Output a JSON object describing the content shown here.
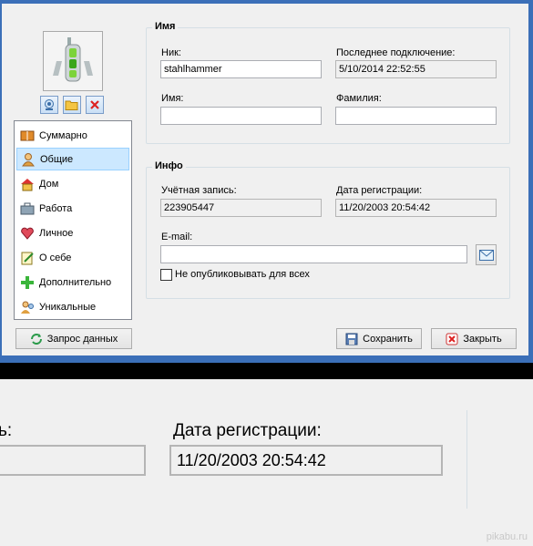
{
  "colors": {
    "accent": "#3b6fb8",
    "selection": "#cce8ff"
  },
  "avatar": {
    "icon": "phone-icon"
  },
  "avatar_buttons": [
    {
      "name": "webcam-icon"
    },
    {
      "name": "folder-icon"
    },
    {
      "name": "delete-icon"
    }
  ],
  "nav": {
    "items": [
      {
        "label": "Суммарно",
        "icon": "book-icon"
      },
      {
        "label": "Общие",
        "icon": "user-icon",
        "selected": true
      },
      {
        "label": "Дом",
        "icon": "house-icon"
      },
      {
        "label": "Работа",
        "icon": "briefcase-icon"
      },
      {
        "label": "Личное",
        "icon": "heart-icon"
      },
      {
        "label": "О себе",
        "icon": "notepad-icon"
      },
      {
        "label": "Дополнительно",
        "icon": "plus-icon"
      },
      {
        "label": "Уникальные",
        "icon": "users-icon"
      }
    ]
  },
  "name_group": {
    "title": "Имя",
    "nick_label": "Ник:",
    "nick_value": "stahlhammer",
    "last_connection_label": "Последнее подключение:",
    "last_connection_value": "5/10/2014 22:52:55",
    "first_name_label": "Имя:",
    "first_name_value": "",
    "last_name_label": "Фамилия:",
    "last_name_value": ""
  },
  "info_group": {
    "title": "Инфо",
    "account_label": "Учётная запись:",
    "account_value": "223905447",
    "reg_date_label": "Дата регистрации:",
    "reg_date_value": "11/20/2003 20:54:42",
    "email_label": "E-mail:",
    "email_value": "",
    "hide_label": "Не опубликовывать для всех"
  },
  "buttons": {
    "request": "Запрос данных",
    "save": "Сохранить",
    "close": "Закрыть"
  },
  "zoom": {
    "label_fragment": "ь:",
    "reg_date_label": "Дата регистрации:",
    "reg_date_value": "11/20/2003 20:54:42"
  },
  "watermark": "pikabu.ru"
}
